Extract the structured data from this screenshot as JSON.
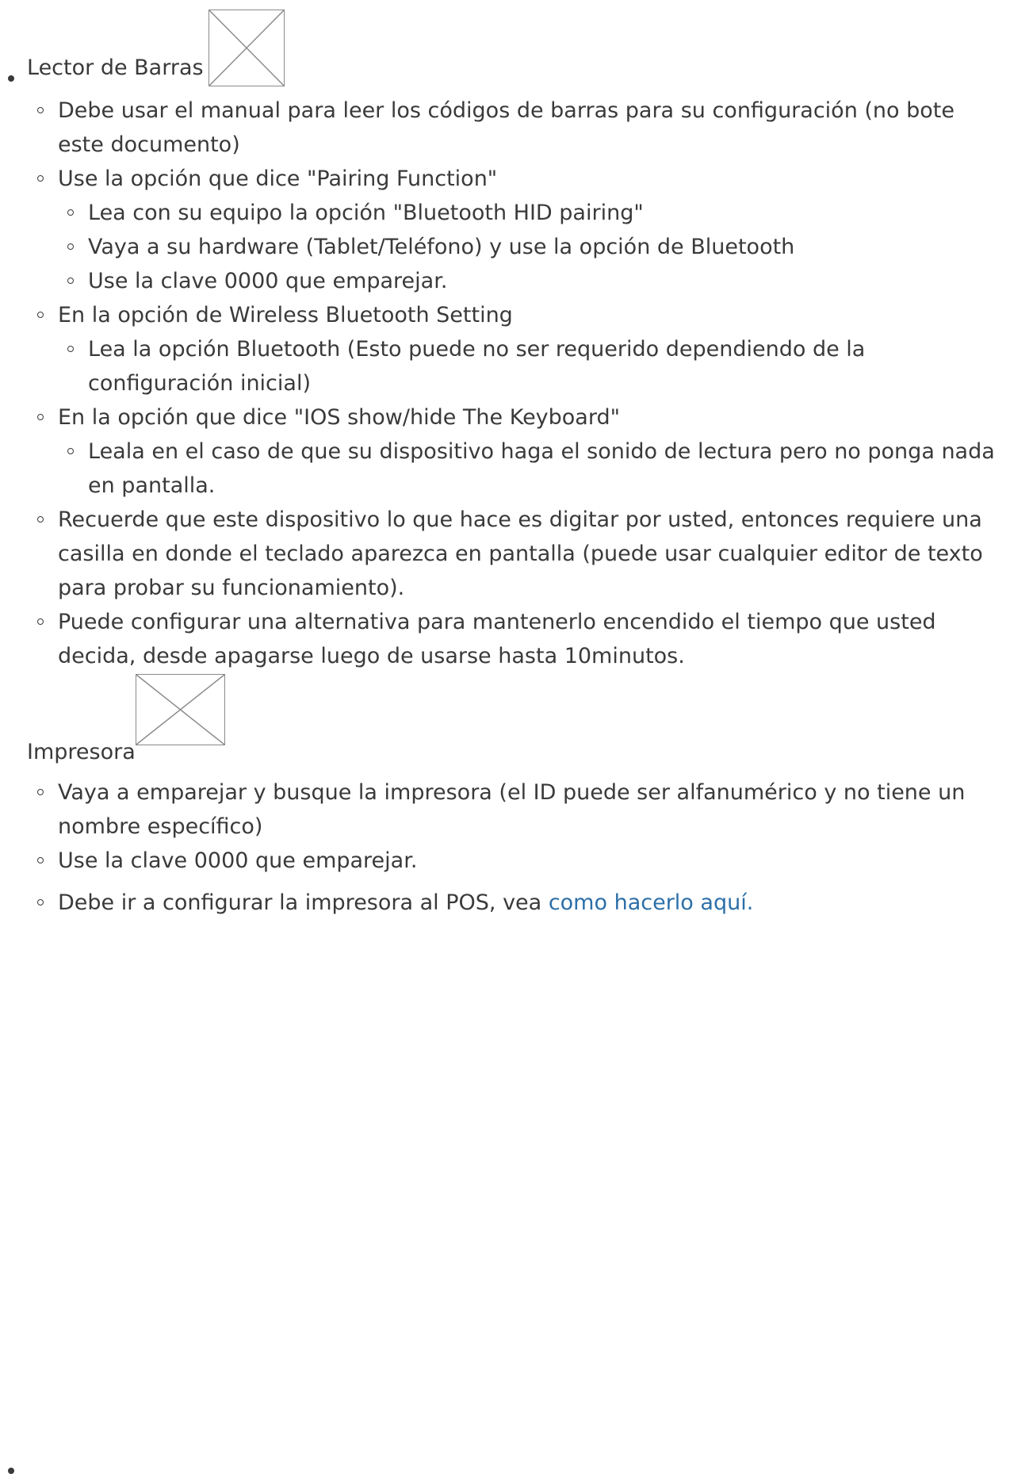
{
  "lector": {
    "title": "Lector de Barras",
    "items": [
      "Debe usar el manual para leer los códigos de barras para su configuración (no bote este documento)",
      "Use la opción que dice \"Pairing Function\"",
      "En la opción de Wireless Bluetooth Setting",
      "En la opción que dice \"IOS show/hide The Keyboard\"",
      "Recuerde que este dispositivo lo que hace es digitar por usted, entonces requiere una casilla en donde el teclado aparezca en pantalla (puede usar cualquier editor de texto para probar su funcionamiento).",
      "Puede configurar una alternativa para mantenerlo encendido el tiempo que usted decida, desde apagarse luego de usarse hasta 10minutos."
    ],
    "pairing_sub": [
      "Lea con su equipo la opción \"Bluetooth HID pairing\"",
      "Vaya a su hardware (Tablet/Teléfono) y use la opción de Bluetooth",
      "Use la clave 0000 que emparejar."
    ],
    "wireless_sub": [
      "Lea la opción Bluetooth (Esto puede no ser requerido dependiendo de la configuración inicial)"
    ],
    "ios_sub": [
      "Leala en el caso de que su dispositivo haga el sonido de lectura pero no ponga nada en pantalla."
    ]
  },
  "impresora": {
    "title": "Impresora",
    "items": [
      "Vaya a emparejar y busque la impresora (el ID puede ser alfanumérico y no tiene un nombre específico)",
      "Use la clave 0000 que emparejar."
    ],
    "pos_text": "Debe ir a configurar la impresora al POS, vea ",
    "pos_link": "como hacerlo aquí."
  }
}
